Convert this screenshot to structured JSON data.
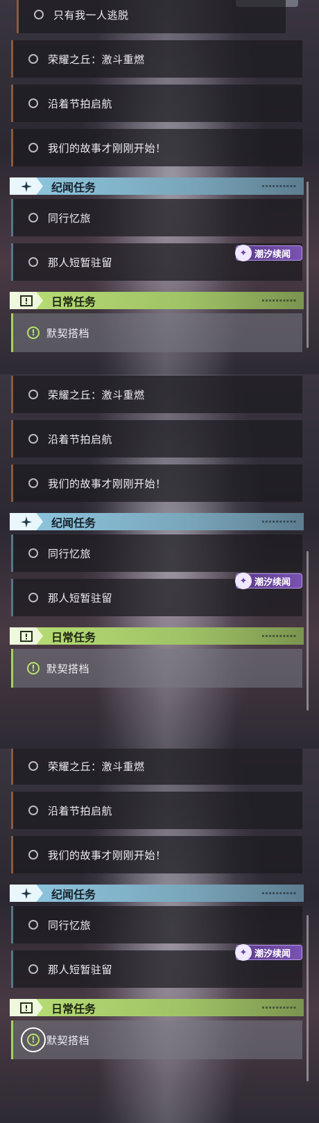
{
  "panels": [
    {
      "top_quest": "只有我一人逃脱",
      "main_quests": [
        "荣耀之丘：激斗重燃",
        "沿着节拍启航",
        "我们的故事才刚刚开始！"
      ],
      "section_story": "纪闻任务",
      "story_quests": [
        "同行忆旅",
        "那人短暂驻留"
      ],
      "section_daily": "日常任务",
      "daily_quests": [
        "默契搭档"
      ],
      "badge": "潮汐续闻"
    },
    {
      "main_quests": [
        "荣耀之丘：激斗重燃",
        "沿着节拍启航",
        "我们的故事才刚刚开始！"
      ],
      "section_story": "纪闻任务",
      "story_quests": [
        "同行忆旅",
        "那人短暂驻留"
      ],
      "section_daily": "日常任务",
      "daily_quests": [
        "默契搭档"
      ],
      "badge": "潮汐续闻"
    },
    {
      "main_quests": [
        "荣耀之丘：激斗重燃",
        "沿着节拍启航",
        "我们的故事才刚刚开始！"
      ],
      "section_story": "纪闻任务",
      "story_quests": [
        "同行忆旅",
        "那人短暂驻留"
      ],
      "section_daily": "日常任务",
      "daily_quests": [
        "默契搭档"
      ],
      "badge": "潮汐续闻"
    }
  ],
  "icons": {
    "quest_status": "circle-icon",
    "story_header": "sparkle-icon",
    "daily_header": "notice-icon",
    "daily_quest": "exclamation-icon",
    "badge": "tide-icon"
  },
  "colors": {
    "story_accent": "#8fc9e2",
    "daily_accent": "#b9df76",
    "badge_accent": "#7a52b3"
  }
}
